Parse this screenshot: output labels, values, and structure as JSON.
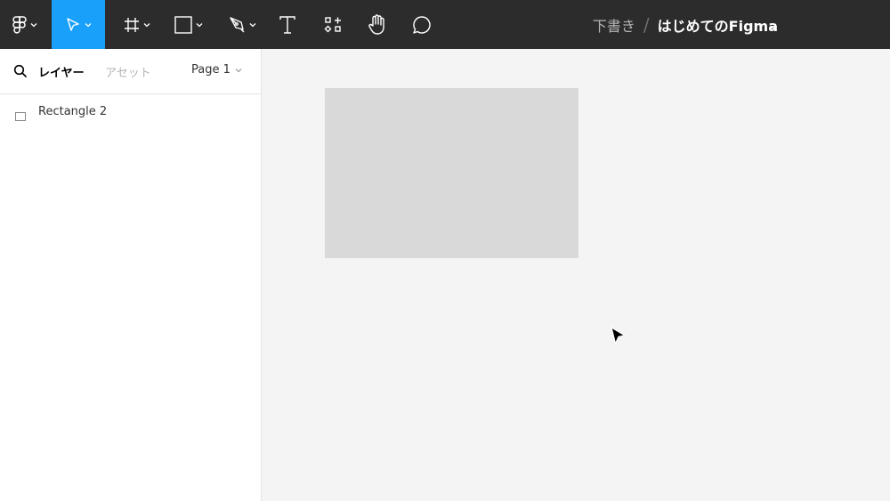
{
  "toolbar": {
    "tools": [
      {
        "name": "main-menu",
        "icon": "figma-logo-icon"
      },
      {
        "name": "move-tool",
        "icon": "cursor-arrow-icon",
        "active": true
      },
      {
        "name": "frame-tool",
        "icon": "frame-hash-icon"
      },
      {
        "name": "shape-tool",
        "icon": "square-icon"
      },
      {
        "name": "pen-tool",
        "icon": "pen-nib-icon"
      },
      {
        "name": "text-tool",
        "icon": "text-t-icon"
      },
      {
        "name": "resources-tool",
        "icon": "components-icon"
      },
      {
        "name": "hand-tool",
        "icon": "hand-icon"
      },
      {
        "name": "comment-tool",
        "icon": "speech-bubble-icon"
      }
    ],
    "accent_color": "#18a0fb",
    "breadcrumb": {
      "project": "下書き",
      "separator": "/",
      "file": "はじめてのFigma"
    }
  },
  "left_panel": {
    "tabs": {
      "layers": "レイヤー",
      "assets": "アセット"
    },
    "page": "Page 1",
    "layers": [
      {
        "label": "Rectangle 2",
        "icon": "rectangle-icon"
      }
    ]
  },
  "canvas": {
    "shape_fill": "#d9d9d9",
    "background": "#f4f4f4"
  }
}
